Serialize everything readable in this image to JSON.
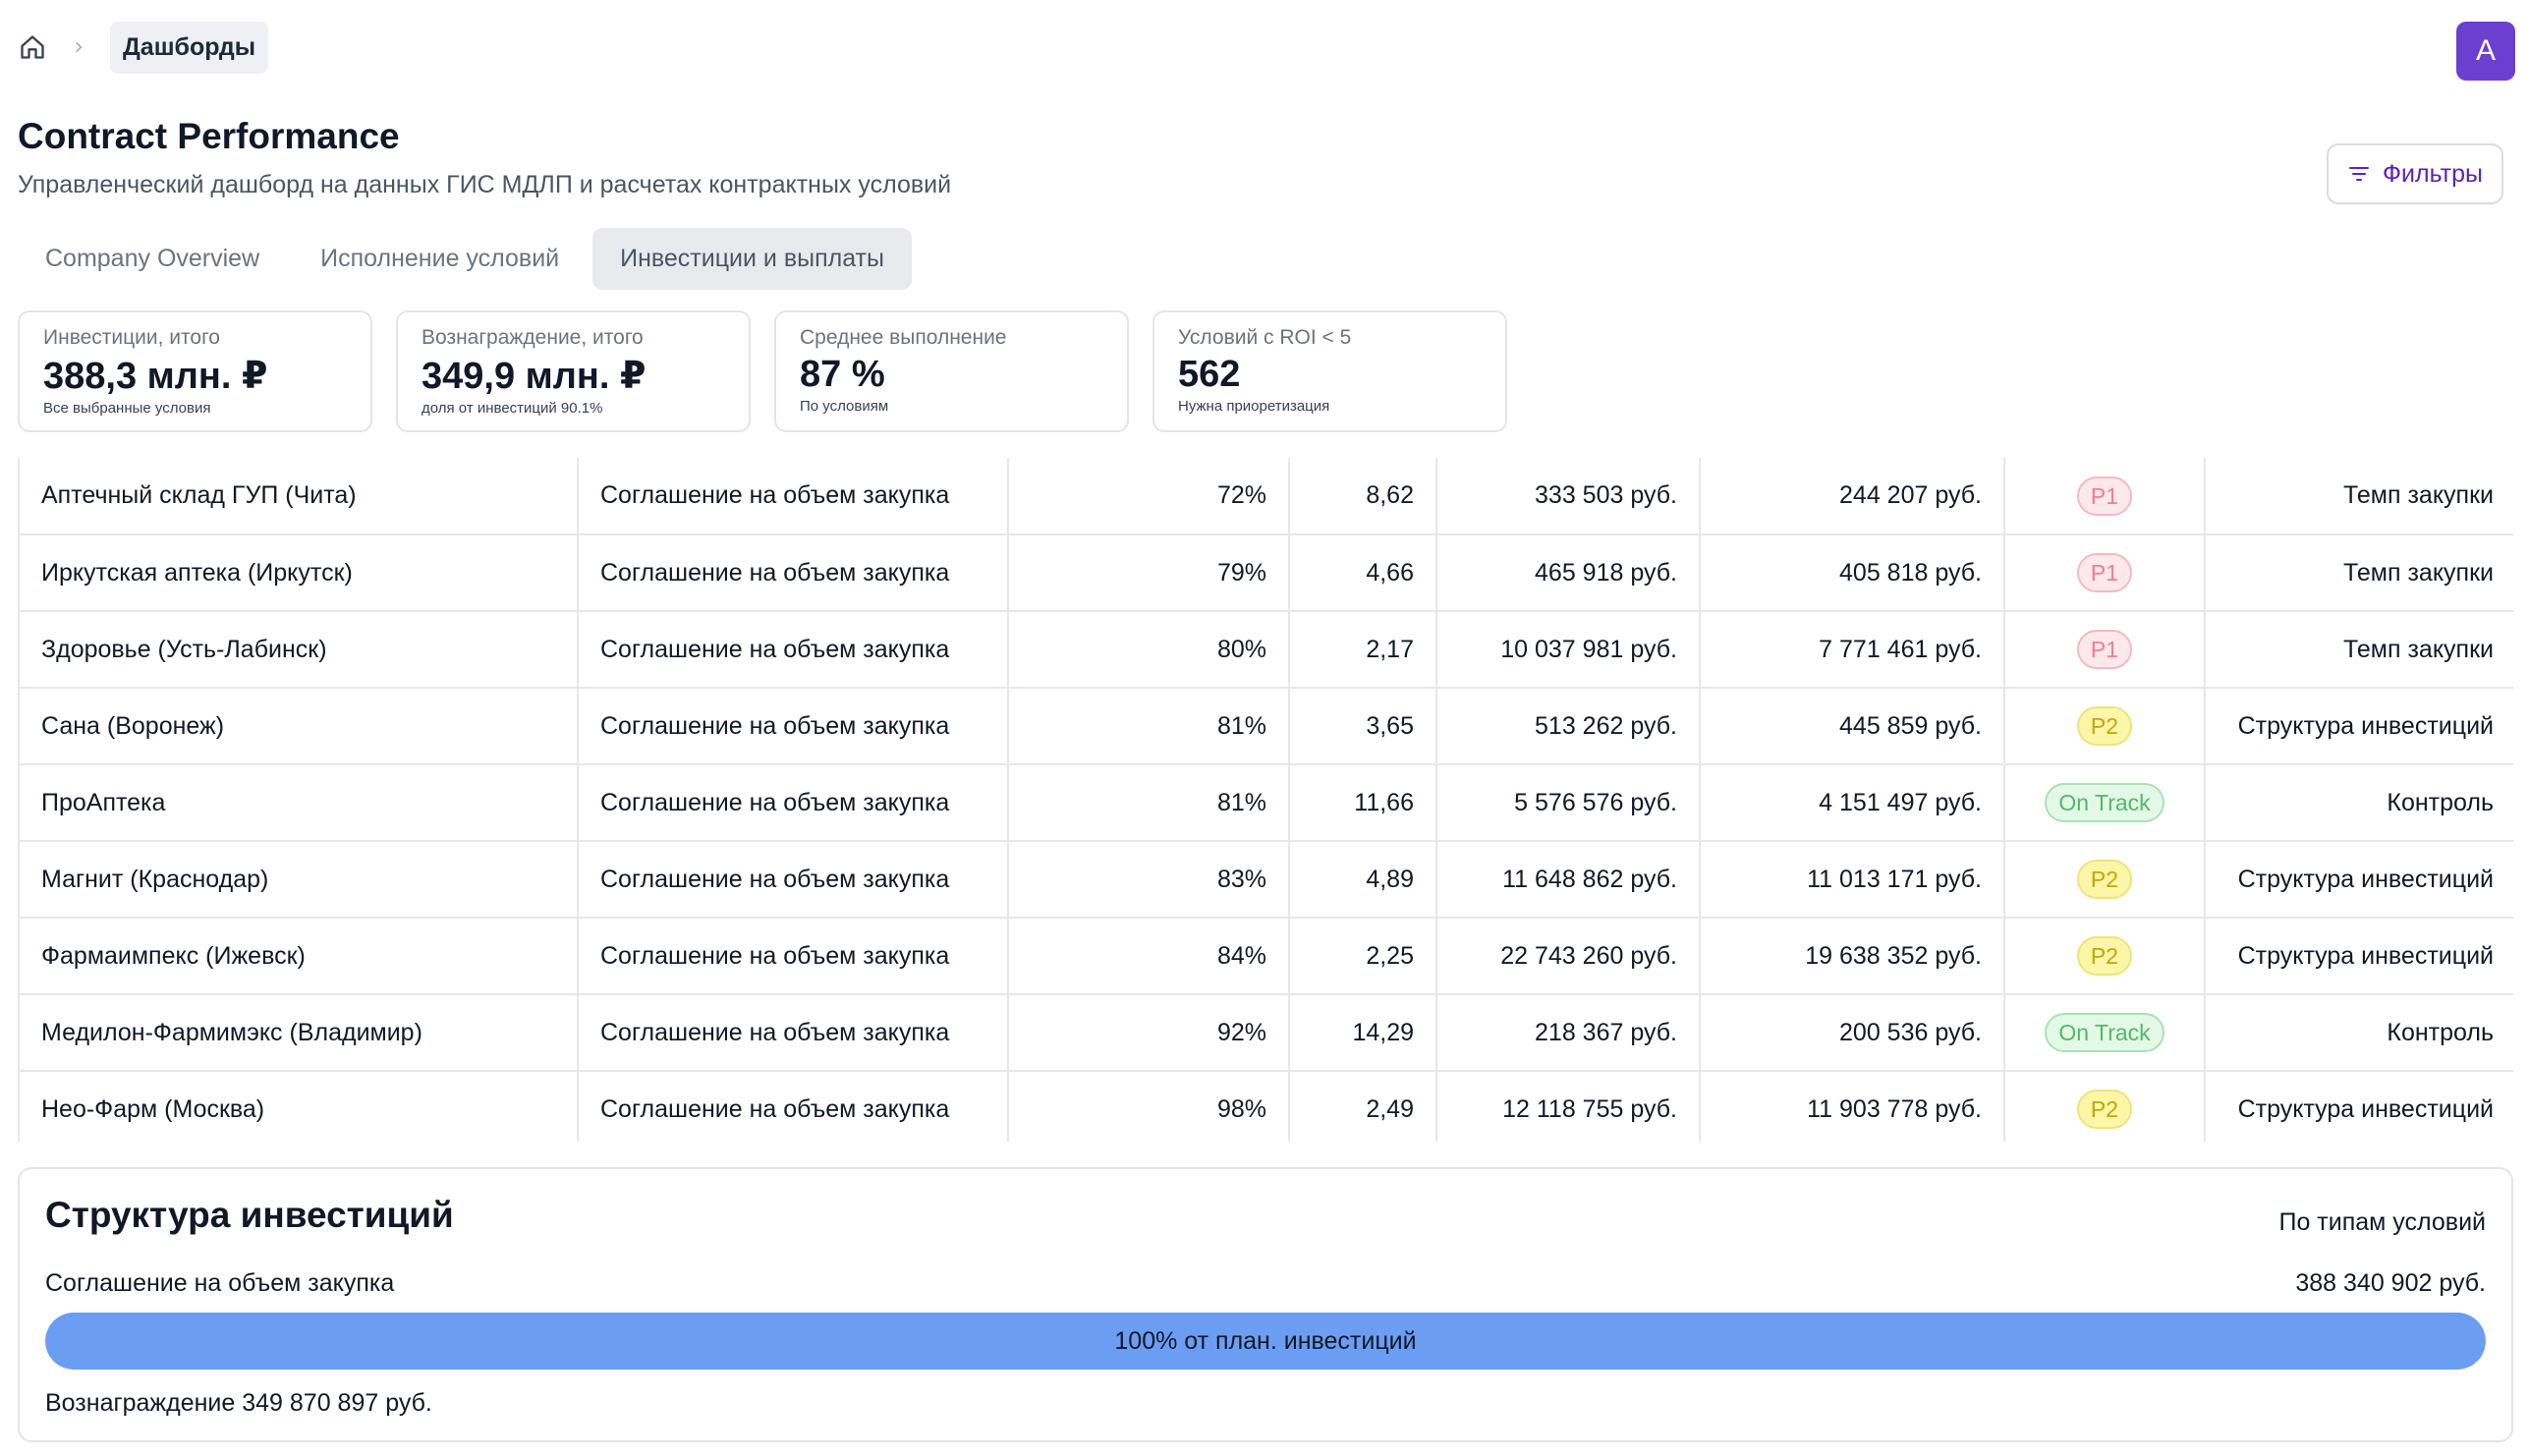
{
  "breadcrumb": {
    "current": "Дашборды"
  },
  "user": {
    "avatar_letter": "A"
  },
  "header": {
    "title": "Contract Performance",
    "subtitle": "Управленческий дашборд на данных ГИС МДЛП и расчетах контрактных условий",
    "filters_label": "Фильтры"
  },
  "tabs": [
    {
      "label": "Company Overview",
      "active": false
    },
    {
      "label": "Исполнение условий",
      "active": false
    },
    {
      "label": "Инвестиции и выплаты",
      "active": true
    }
  ],
  "kpis": [
    {
      "label": "Инвестиции, итого",
      "value": "388,3 млн. ₽",
      "note": "Все выбранные условия"
    },
    {
      "label": "Вознаграждение, итого",
      "value": "349,9 млн. ₽",
      "note": "доля от инвестиций 90.1%"
    },
    {
      "label": "Среднее выполнение",
      "value": "87 %",
      "note": "По условиям"
    },
    {
      "label": "Условий с ROI < 5",
      "value": "562",
      "note": "Нужна приоретизация"
    }
  ],
  "table": {
    "rows": [
      {
        "name": "Аптечный склад ГУП (Чита)",
        "condition": "Соглашение на объем закупка",
        "completion": "72%",
        "roi": "8,62",
        "investment": "333 503 руб.",
        "reward": "244 207 руб.",
        "priority": "P1",
        "priority_type": "p1",
        "focus": "Темп закупки"
      },
      {
        "name": "Иркутская аптека (Иркутск)",
        "condition": "Соглашение на объем закупка",
        "completion": "79%",
        "roi": "4,66",
        "investment": "465 918 руб.",
        "reward": "405 818 руб.",
        "priority": "P1",
        "priority_type": "p1",
        "focus": "Темп закупки"
      },
      {
        "name": "Здоровье (Усть-Лабинск)",
        "condition": "Соглашение на объем закупка",
        "completion": "80%",
        "roi": "2,17",
        "investment": "10 037 981 руб.",
        "reward": "7 771 461 руб.",
        "priority": "P1",
        "priority_type": "p1",
        "focus": "Темп закупки"
      },
      {
        "name": "Сана (Воронеж)",
        "condition": "Соглашение на объем закупка",
        "completion": "81%",
        "roi": "3,65",
        "investment": "513 262 руб.",
        "reward": "445 859 руб.",
        "priority": "P2",
        "priority_type": "p2",
        "focus": "Структура инвестиций"
      },
      {
        "name": "ПроАптека",
        "condition": "Соглашение на объем закупка",
        "completion": "81%",
        "roi": "11,66",
        "investment": "5 576 576 руб.",
        "reward": "4 151 497 руб.",
        "priority": "On Track",
        "priority_type": "ok",
        "focus": "Контроль"
      },
      {
        "name": "Магнит (Краснодар)",
        "condition": "Соглашение на объем закупка",
        "completion": "83%",
        "roi": "4,89",
        "investment": "11 648 862 руб.",
        "reward": "11 013 171 руб.",
        "priority": "P2",
        "priority_type": "p2",
        "focus": "Структура инвестиций"
      },
      {
        "name": "Фармаимпекс (Ижевск)",
        "condition": "Соглашение на объем закупка",
        "completion": "84%",
        "roi": "2,25",
        "investment": "22 743 260 руб.",
        "reward": "19 638 352 руб.",
        "priority": "P2",
        "priority_type": "p2",
        "focus": "Структура инвестиций"
      },
      {
        "name": "Медилон-Фармимэкс (Владимир)",
        "condition": "Соглашение на объем закупка",
        "completion": "92%",
        "roi": "14,29",
        "investment": "218 367 руб.",
        "reward": "200 536 руб.",
        "priority": "On Track",
        "priority_type": "ok",
        "focus": "Контроль"
      },
      {
        "name": "Нео-Фарм (Москва)",
        "condition": "Соглашение на объем закупка",
        "completion": "98%",
        "roi": "2,49",
        "investment": "12 118 755 руб.",
        "reward": "11 903 778 руб.",
        "priority": "P2",
        "priority_type": "p2",
        "focus": "Структура инвестиций"
      }
    ]
  },
  "structure": {
    "title": "Структура инвестиций",
    "side_label": "По типам условий",
    "condition": "Соглашение на объем закупка",
    "amount": "388 340 902 руб.",
    "bar_fraction": 1.0,
    "bar_label": "100% от план. инвестиций",
    "reward": "Вознаграждение 349 870 897 руб."
  },
  "colors": {
    "accent": "#6d3fd0",
    "bar": "#6b9ef3",
    "p1": "#f37c92",
    "p2": "#c9a300",
    "on_track": "#52b86a"
  }
}
